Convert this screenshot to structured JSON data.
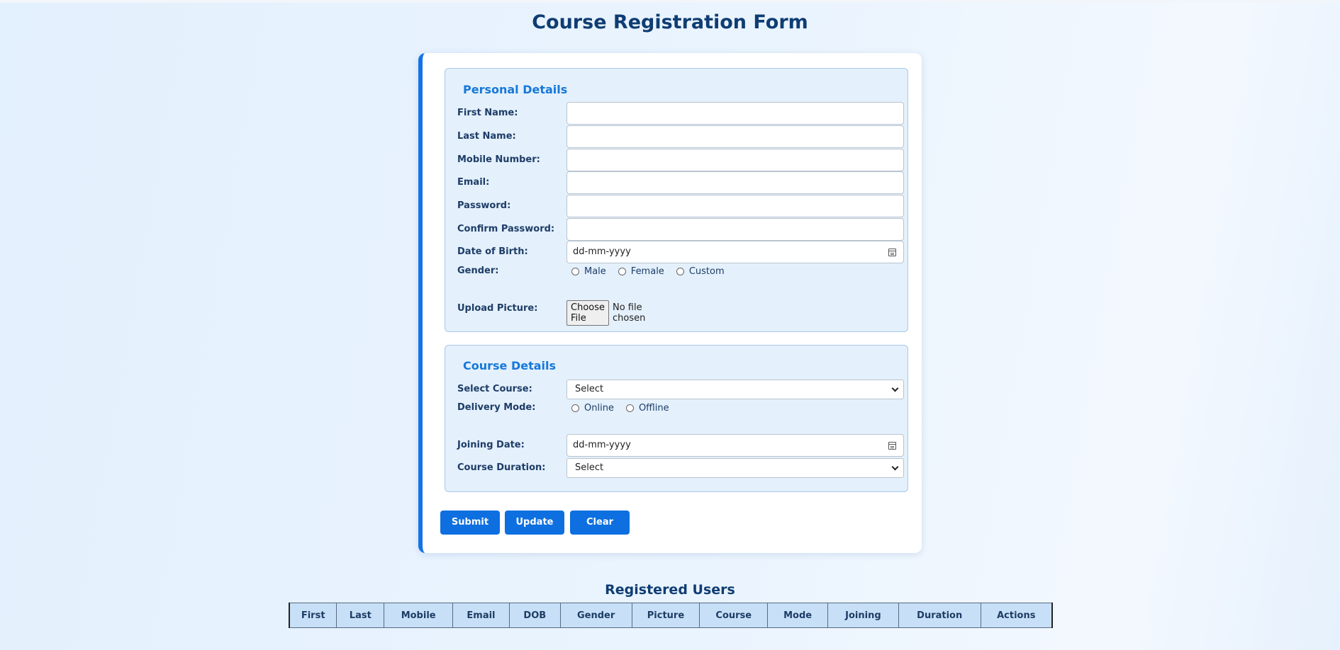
{
  "page_title": "Course Registration Form",
  "personal": {
    "legend": "Personal Details",
    "first_name_label": "First Name:",
    "last_name_label": "Last Name:",
    "mobile_label": "Mobile Number:",
    "email_label": "Email:",
    "password_label": "Password:",
    "confirm_password_label": "Confirm Password:",
    "dob_label": "Date of Birth:",
    "dob_value": "dd-mm-yyyy",
    "gender_label": "Gender:",
    "gender_options": [
      "Male",
      "Female",
      "Custom"
    ],
    "upload_label": "Upload Picture:",
    "choose_file_label": "Choose File",
    "no_file_text": "No file chosen"
  },
  "course": {
    "legend": "Course Details",
    "select_course_label": "Select Course:",
    "select_course_value": "Select",
    "delivery_mode_label": "Delivery Mode:",
    "delivery_options": [
      "Online",
      "Offline"
    ],
    "joining_date_label": "Joining Date:",
    "joining_date_value": "dd-mm-yyyy",
    "duration_label": "Course Duration:",
    "duration_value": "Select"
  },
  "buttons": {
    "submit": "Submit",
    "update": "Update",
    "clear": "Clear"
  },
  "users_table": {
    "title": "Registered Users",
    "columns": [
      "First",
      "Last",
      "Mobile",
      "Email",
      "DOB",
      "Gender",
      "Picture",
      "Course",
      "Mode",
      "Joining",
      "Duration",
      "Actions"
    ]
  },
  "colors": {
    "accent": "#1473e6",
    "button": "#0d6fe0",
    "title": "#0f3d73",
    "legend": "#1678d8",
    "section_bg": "#e4f0fc",
    "table_header_bg": "#c8e0f7"
  },
  "icons": [
    "calendar-icon",
    "chevron-down-icon"
  ]
}
